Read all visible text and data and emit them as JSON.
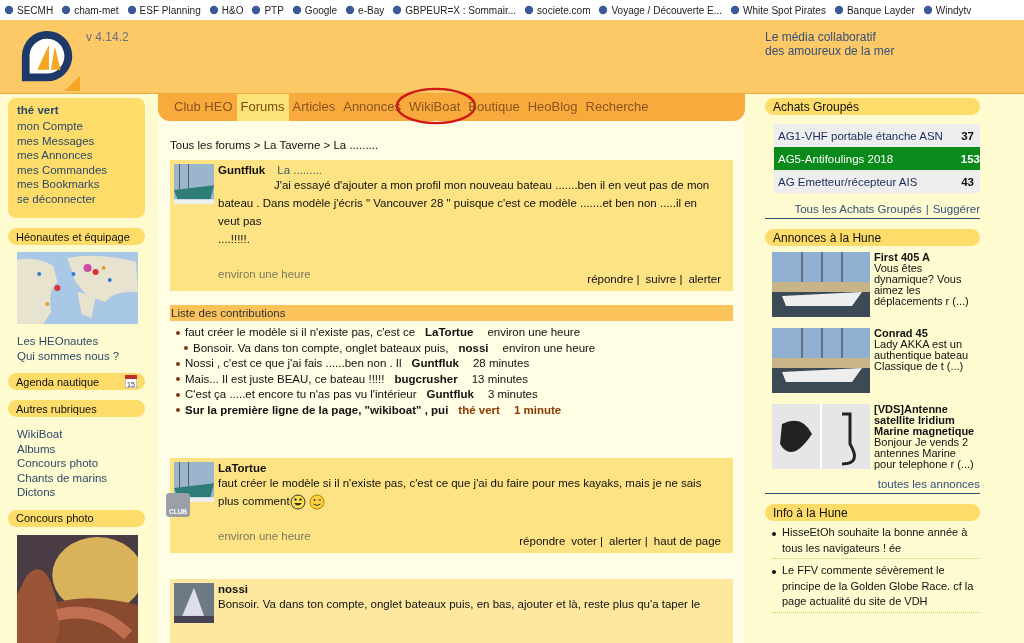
{
  "bookmarks": [
    {
      "label": "SECMH"
    },
    {
      "label": "cham-met"
    },
    {
      "label": "ESF Planning"
    },
    {
      "label": "H&O"
    },
    {
      "label": "PTP"
    },
    {
      "label": "Google"
    },
    {
      "label": "e-Bay"
    },
    {
      "label": "GBPEUR=X : Sommair..."
    },
    {
      "label": "societe.com"
    },
    {
      "label": "Voyage / Découverte E..."
    },
    {
      "label": "White Spot Pirates"
    },
    {
      "label": "Banque Layder"
    },
    {
      "label": "Windytv"
    }
  ],
  "header": {
    "version": "v 4.14.2",
    "tagline": [
      "Le média collaboratif",
      "des amoureux de la mer"
    ]
  },
  "nav": [
    {
      "label": "Club HEO",
      "selected": false
    },
    {
      "label": "Forums",
      "selected": true
    },
    {
      "label": "Articles",
      "selected": false
    },
    {
      "label": "Annonces",
      "selected": false
    },
    {
      "label": "WikiBoat",
      "selected": false,
      "circled": true
    },
    {
      "label": "Boutique",
      "selected": false
    },
    {
      "label": "HeoBlog",
      "selected": false
    },
    {
      "label": "Recherche",
      "selected": false
    }
  ],
  "user": {
    "name": "thé vert",
    "links": [
      "mon Compte",
      "mes Messages",
      "mes Annonces",
      "mes Commandes",
      "mes Bookmarks",
      "se déconnecter"
    ]
  },
  "left_sections": [
    {
      "title": "Héonautes et équipage",
      "kind": "map",
      "links": [
        "Les HEOnautes",
        "Qui sommes nous ?"
      ]
    },
    {
      "title": "Agenda nautique",
      "kind": "calendar",
      "calendar_day": "15"
    },
    {
      "title": "Autres rubriques",
      "kind": "links",
      "links": [
        "WikiBoat",
        "Albums",
        "Concours photo",
        "Chants de marins",
        "Dictons"
      ]
    },
    {
      "title": "Concours photo"
    }
  ],
  "breadcrumb": "Tous les forums > La Taverne > La .........",
  "posts": [
    {
      "author": "Guntfluk",
      "title": "La .........",
      "body": [
        "J'ai essayé d'ajouter a mon profil mon nouveau bateau .......ben il en veut pas de mon bateau . Dans modèle j'écris \" Vancouver 28 \" puisque c'est ce modèle .......et ben non .....il en veut pas",
        "....!!!!!."
      ],
      "indent": true,
      "smileys": false,
      "club": false,
      "time": "environ une heure",
      "actions": [
        "répondre |",
        "suivre |",
        "alerter"
      ]
    },
    {
      "author": "LaTortue",
      "body": [
        "faut créer le modèle si il n'existe pas, c'est ce que j'ai du faire pour mes kayaks, mais je ne sais plus comment"
      ],
      "indent": false,
      "smileys": true,
      "club": true,
      "club_label": "CLUB",
      "time": "environ une heure",
      "actions": [
        "répondre",
        "voter |",
        "alerter |",
        "haut de page"
      ]
    }
  ],
  "contributions": {
    "title": "Liste des contributions",
    "items": [
      {
        "text": "faut créer le modèle si il n'existe pas, c'est ce",
        "author": "LaTortue",
        "time": "environ une heure",
        "current": false,
        "children": [
          {
            "text": "Bonsoir. Va dans ton compte, onglet bateaux puis,",
            "author": "nossi",
            "time": "environ une heure",
            "current": false
          }
        ]
      },
      {
        "text": "Nossi , c'est ce que j'ai fais ......ben non . Il",
        "author": "Guntfluk",
        "time": "28 minutes",
        "current": false
      },
      {
        "text": "Mais... Il est juste BEAU, ce bateau !!!!!",
        "author": "bugcrusher",
        "time": "13 minutes",
        "current": false
      },
      {
        "text": "C'est ça .....et encore tu n'as pas vu l'intérieur",
        "author": "Guntfluk",
        "time": "3 minutes",
        "current": false
      },
      {
        "text": "Sur la première ligne de la page, \"wikiboat\" , pui",
        "author": "thé vert",
        "time": "1 minute",
        "current": true
      }
    ]
  },
  "last_post": {
    "author": "nossi",
    "body": "Bonsoir. Va dans ton compte, onglet bateaux puis, en bas, ajouter et là, reste plus qu'a taper le"
  },
  "achats": {
    "title": "Achats Groupés",
    "rows": [
      {
        "name": "AG1-VHF portable étanche ASN",
        "count": "37",
        "selected": false
      },
      {
        "name": "AG5-Antifoulings 2018",
        "count": "153",
        "selected": true
      },
      {
        "name": "AG Emetteur/récepteur AIS",
        "count": "43",
        "selected": false
      }
    ],
    "links": [
      "Tous les Achats Groupés",
      "|",
      "Suggérer"
    ]
  },
  "annonces": {
    "title": "Annonces à la Hune",
    "items": [
      {
        "title": "First 405 A",
        "text": "Vous êtes dynamique? Vous aimez les déplacements r (...)",
        "kind": "boat"
      },
      {
        "title": "Conrad 45",
        "text": "Lady AKKA est un authentique bateau Classique de t (...)",
        "kind": "boat"
      },
      {
        "title": "[VDS]Antenne satellite Iridium Marine magnetique",
        "text": "Bonjour Je vends 2 antennes Marine pour telephone r (...)",
        "kind": "antenna"
      }
    ],
    "more": "toutes les annonces"
  },
  "info": {
    "title": "Info à la Hune",
    "items": [
      "HisseEtOh souhaite la bonne année à tous les navigateurs ! ée",
      "Le FFV commente sévèrement le principe de la Golden Globe Race. cf la page actualité du site de VDH"
    ]
  }
}
